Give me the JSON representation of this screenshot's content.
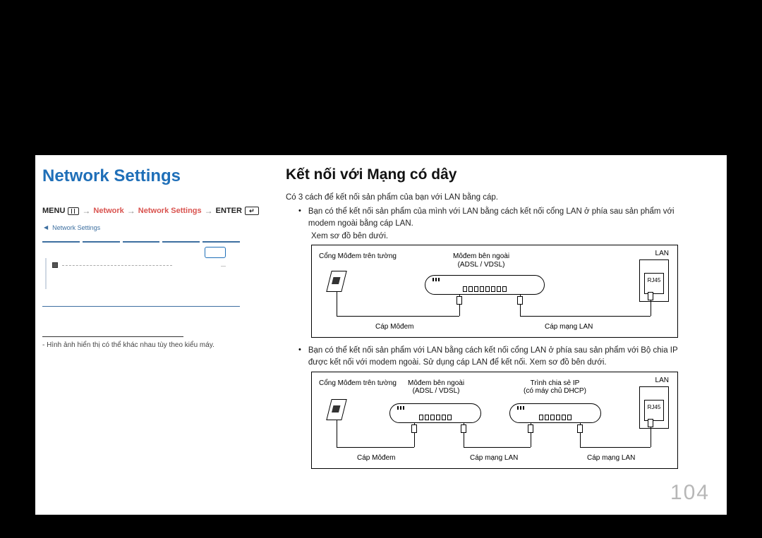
{
  "left": {
    "title": "Network Settings",
    "breadcrumb": {
      "menu": "MENU",
      "network": "Network",
      "settings": "Network Settings",
      "enter": "ENTER"
    },
    "preview_title": "Network Settings",
    "footnote": "- Hình ảnh hiển thị có thể khác nhau tùy theo kiểu máy."
  },
  "right": {
    "heading": "Kết nối với Mạng có dây",
    "intro": "Có 3 cách để kết nối sản phẩm của bạn với LAN bằng cáp.",
    "bullet1": "Bạn có thể kết nối sản phẩm của mình với LAN bằng cách kết nối cổng LAN ở phía sau sản phẩm với modem ngoài bằng cáp LAN.",
    "sub1": "Xem sơ đồ bên dưới.",
    "bullet2": "Bạn có thể kết nối sản phẩm với LAN bằng cách kết nối cổng LAN ở phía sau sản phẩm với Bộ chia IP được kết nối với modem ngoài. Sử dụng cáp LAN để kết nối. Xem sơ đồ bên dưới."
  },
  "diagram": {
    "wall": "Cổng Môđem trên tường",
    "modem": "Môđem bên ngoài",
    "modem_sub": "(ADSL / VDSL)",
    "ipsharer": "Trình chia sẻ IP",
    "ipsharer_sub": "(có máy chủ DHCP)",
    "cable_modem": "Cáp Môđem",
    "cable_lan": "Cáp mạng LAN",
    "lan": "LAN",
    "rj45": "RJ45"
  },
  "page_number": "104"
}
